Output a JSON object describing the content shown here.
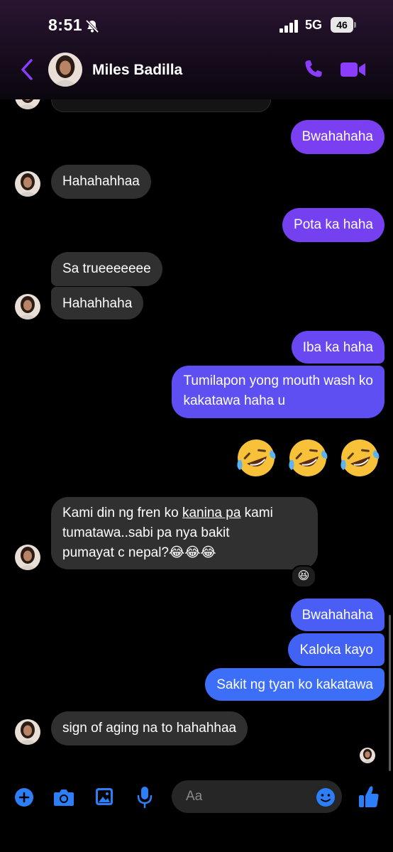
{
  "status": {
    "time": "8:51",
    "network": "5G",
    "battery": "46"
  },
  "header": {
    "contact_name": "Miles Badilla"
  },
  "colors": {
    "accent": "#8b3dff",
    "purple_bubble": "#7b3ff2",
    "blue_bubble": "#3d6ef7",
    "incoming_bubble": "#303030",
    "icon_blue": "#2d7ff9"
  },
  "messages": [
    {
      "from": "me",
      "text": "Bwahahaha"
    },
    {
      "from": "them",
      "text": "Hahahahhaa"
    },
    {
      "from": "me",
      "text": "Pota ka haha"
    },
    {
      "from": "them",
      "text": "Sa trueeeeeee"
    },
    {
      "from": "them",
      "text": "Hahahhaha"
    },
    {
      "from": "me",
      "text": "Iba ka haha"
    },
    {
      "from": "me",
      "text_line1": "Tumilapon yong mouth wash ko",
      "text_line2": "kakatawa haha u"
    },
    {
      "from": "me",
      "emoji": "🤣🤣🤣"
    },
    {
      "from": "them",
      "text_line1_a": "Kami din ng fren ko ",
      "text_line1_link": "kanina pa",
      "text_line1_b": " kami",
      "text_line2": "tumatawa..sabi pa nya bakit",
      "text_line3": "pumayat c nepal?😂😂😂",
      "reaction": "😆"
    },
    {
      "from": "me",
      "text": "Bwahahaha"
    },
    {
      "from": "me",
      "text": "Kaloka kayo"
    },
    {
      "from": "me",
      "text": "Sakit ng tyan ko kakatawa"
    },
    {
      "from": "them",
      "text": "sign of aging na to hahahhaa"
    }
  ],
  "composer": {
    "placeholder": "Aa"
  },
  "icons": [
    "back-chevron-icon",
    "phone-icon",
    "video-camera-icon",
    "plus-icon",
    "camera-icon",
    "image-icon",
    "microphone-icon",
    "emoji-smiley-icon",
    "thumbs-up-icon",
    "bell-slash-icon"
  ]
}
